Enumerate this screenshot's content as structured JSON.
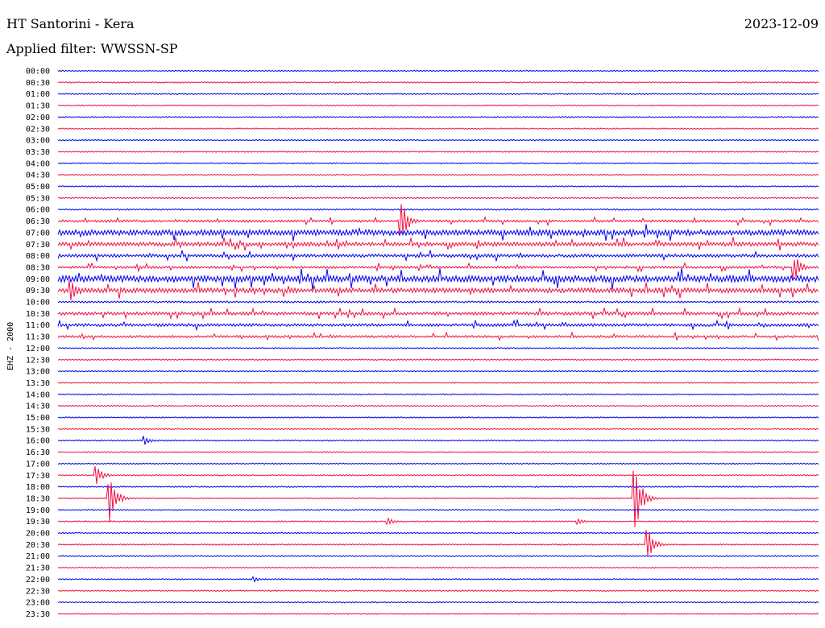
{
  "header": {
    "station": "HT Santorini - Kera",
    "date": "2023-12-09",
    "filter_prefix": "Applied filter: ",
    "filter": "WWSSN-SP"
  },
  "chart_data": {
    "type": "line",
    "title": "HT Santorini - Kera",
    "date": "2023-12-09",
    "filter": "WWSSN-SP",
    "channel_label": "EHZ - 2000",
    "colors": {
      "even_row": "#0000ee",
      "odd_row": "#ee1144"
    },
    "row_labels": [
      "00:00",
      "00:30",
      "01:00",
      "01:30",
      "02:00",
      "02:30",
      "03:00",
      "03:30",
      "04:00",
      "04:30",
      "05:00",
      "05:30",
      "06:00",
      "06:30",
      "07:00",
      "07:30",
      "08:00",
      "08:30",
      "09:00",
      "09:30",
      "10:00",
      "10:30",
      "11:00",
      "11:30",
      "12:00",
      "12:30",
      "13:00",
      "13:30",
      "14:00",
      "14:30",
      "15:00",
      "15:30",
      "16:00",
      "16:30",
      "17:00",
      "17:30",
      "18:00",
      "18:30",
      "19:00",
      "19:30",
      "20:00",
      "20:30",
      "21:00",
      "21:30",
      "22:00",
      "22:30",
      "23:00",
      "23:30"
    ],
    "row_minutes": 30,
    "noise_level": [
      0.8,
      0.8,
      0.8,
      0.8,
      0.8,
      0.8,
      0.8,
      0.8,
      0.8,
      0.8,
      0.8,
      0.9,
      0.9,
      1.5,
      3.5,
      2.5,
      2.0,
      1.5,
      4.0,
      3.0,
      1.2,
      2.0,
      1.8,
      1.5,
      0.8,
      0.8,
      0.8,
      0.8,
      0.8,
      0.8,
      0.8,
      0.8,
      0.8,
      0.8,
      0.8,
      0.8,
      0.8,
      0.8,
      0.8,
      0.8,
      0.8,
      0.8,
      0.8,
      0.8,
      0.8,
      0.8,
      0.8,
      0.8
    ],
    "events": [
      {
        "row": 13,
        "minute": 13.5,
        "amplitude": 30
      },
      {
        "row": 17,
        "minute": 29,
        "amplitude": 20
      },
      {
        "row": 19,
        "minute": 0.5,
        "amplitude": 20
      },
      {
        "row": 32,
        "minute": 3.4,
        "amplitude": 6
      },
      {
        "row": 35,
        "minute": 1.5,
        "amplitude": 12
      },
      {
        "row": 37,
        "minute": 2.0,
        "amplitude": 35
      },
      {
        "row": 39,
        "minute": 13,
        "amplitude": 5
      },
      {
        "row": 39,
        "minute": 20.5,
        "amplitude": 4
      },
      {
        "row": 37,
        "minute": 22.7,
        "amplitude": 55
      },
      {
        "row": 41,
        "minute": 23.2,
        "amplitude": 25
      },
      {
        "row": 44,
        "minute": 7.7,
        "amplitude": 4
      }
    ]
  }
}
